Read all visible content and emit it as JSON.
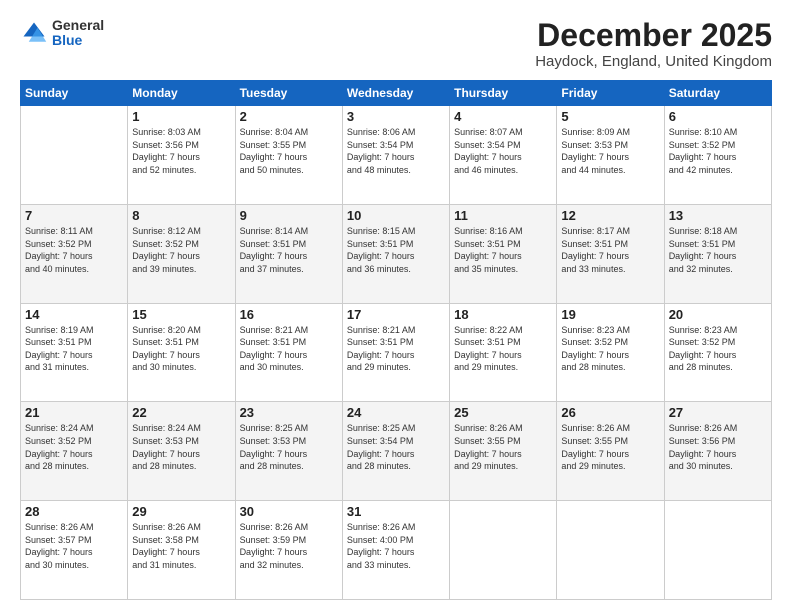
{
  "logo": {
    "general": "General",
    "blue": "Blue"
  },
  "header": {
    "title": "December 2025",
    "subtitle": "Haydock, England, United Kingdom"
  },
  "weekdays": [
    "Sunday",
    "Monday",
    "Tuesday",
    "Wednesday",
    "Thursday",
    "Friday",
    "Saturday"
  ],
  "weeks": [
    [
      {
        "day": "",
        "info": ""
      },
      {
        "day": "1",
        "info": "Sunrise: 8:03 AM\nSunset: 3:56 PM\nDaylight: 7 hours\nand 52 minutes."
      },
      {
        "day": "2",
        "info": "Sunrise: 8:04 AM\nSunset: 3:55 PM\nDaylight: 7 hours\nand 50 minutes."
      },
      {
        "day": "3",
        "info": "Sunrise: 8:06 AM\nSunset: 3:54 PM\nDaylight: 7 hours\nand 48 minutes."
      },
      {
        "day": "4",
        "info": "Sunrise: 8:07 AM\nSunset: 3:54 PM\nDaylight: 7 hours\nand 46 minutes."
      },
      {
        "day": "5",
        "info": "Sunrise: 8:09 AM\nSunset: 3:53 PM\nDaylight: 7 hours\nand 44 minutes."
      },
      {
        "day": "6",
        "info": "Sunrise: 8:10 AM\nSunset: 3:52 PM\nDaylight: 7 hours\nand 42 minutes."
      }
    ],
    [
      {
        "day": "7",
        "info": "Sunrise: 8:11 AM\nSunset: 3:52 PM\nDaylight: 7 hours\nand 40 minutes."
      },
      {
        "day": "8",
        "info": "Sunrise: 8:12 AM\nSunset: 3:52 PM\nDaylight: 7 hours\nand 39 minutes."
      },
      {
        "day": "9",
        "info": "Sunrise: 8:14 AM\nSunset: 3:51 PM\nDaylight: 7 hours\nand 37 minutes."
      },
      {
        "day": "10",
        "info": "Sunrise: 8:15 AM\nSunset: 3:51 PM\nDaylight: 7 hours\nand 36 minutes."
      },
      {
        "day": "11",
        "info": "Sunrise: 8:16 AM\nSunset: 3:51 PM\nDaylight: 7 hours\nand 35 minutes."
      },
      {
        "day": "12",
        "info": "Sunrise: 8:17 AM\nSunset: 3:51 PM\nDaylight: 7 hours\nand 33 minutes."
      },
      {
        "day": "13",
        "info": "Sunrise: 8:18 AM\nSunset: 3:51 PM\nDaylight: 7 hours\nand 32 minutes."
      }
    ],
    [
      {
        "day": "14",
        "info": "Sunrise: 8:19 AM\nSunset: 3:51 PM\nDaylight: 7 hours\nand 31 minutes."
      },
      {
        "day": "15",
        "info": "Sunrise: 8:20 AM\nSunset: 3:51 PM\nDaylight: 7 hours\nand 30 minutes."
      },
      {
        "day": "16",
        "info": "Sunrise: 8:21 AM\nSunset: 3:51 PM\nDaylight: 7 hours\nand 30 minutes."
      },
      {
        "day": "17",
        "info": "Sunrise: 8:21 AM\nSunset: 3:51 PM\nDaylight: 7 hours\nand 29 minutes."
      },
      {
        "day": "18",
        "info": "Sunrise: 8:22 AM\nSunset: 3:51 PM\nDaylight: 7 hours\nand 29 minutes."
      },
      {
        "day": "19",
        "info": "Sunrise: 8:23 AM\nSunset: 3:52 PM\nDaylight: 7 hours\nand 28 minutes."
      },
      {
        "day": "20",
        "info": "Sunrise: 8:23 AM\nSunset: 3:52 PM\nDaylight: 7 hours\nand 28 minutes."
      }
    ],
    [
      {
        "day": "21",
        "info": "Sunrise: 8:24 AM\nSunset: 3:52 PM\nDaylight: 7 hours\nand 28 minutes."
      },
      {
        "day": "22",
        "info": "Sunrise: 8:24 AM\nSunset: 3:53 PM\nDaylight: 7 hours\nand 28 minutes."
      },
      {
        "day": "23",
        "info": "Sunrise: 8:25 AM\nSunset: 3:53 PM\nDaylight: 7 hours\nand 28 minutes."
      },
      {
        "day": "24",
        "info": "Sunrise: 8:25 AM\nSunset: 3:54 PM\nDaylight: 7 hours\nand 28 minutes."
      },
      {
        "day": "25",
        "info": "Sunrise: 8:26 AM\nSunset: 3:55 PM\nDaylight: 7 hours\nand 29 minutes."
      },
      {
        "day": "26",
        "info": "Sunrise: 8:26 AM\nSunset: 3:55 PM\nDaylight: 7 hours\nand 29 minutes."
      },
      {
        "day": "27",
        "info": "Sunrise: 8:26 AM\nSunset: 3:56 PM\nDaylight: 7 hours\nand 30 minutes."
      }
    ],
    [
      {
        "day": "28",
        "info": "Sunrise: 8:26 AM\nSunset: 3:57 PM\nDaylight: 7 hours\nand 30 minutes."
      },
      {
        "day": "29",
        "info": "Sunrise: 8:26 AM\nSunset: 3:58 PM\nDaylight: 7 hours\nand 31 minutes."
      },
      {
        "day": "30",
        "info": "Sunrise: 8:26 AM\nSunset: 3:59 PM\nDaylight: 7 hours\nand 32 minutes."
      },
      {
        "day": "31",
        "info": "Sunrise: 8:26 AM\nSunset: 4:00 PM\nDaylight: 7 hours\nand 33 minutes."
      },
      {
        "day": "",
        "info": ""
      },
      {
        "day": "",
        "info": ""
      },
      {
        "day": "",
        "info": ""
      }
    ]
  ]
}
